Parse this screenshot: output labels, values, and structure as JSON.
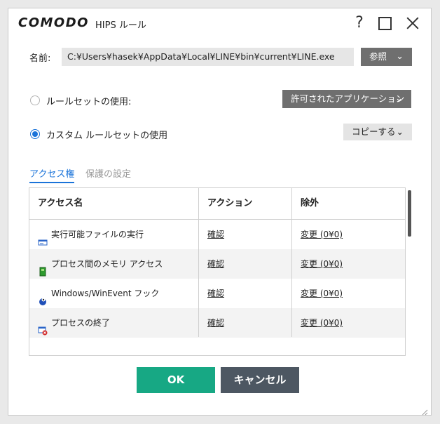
{
  "window": {
    "logo": "COMODO",
    "title": "HIPS ルール",
    "help": "?"
  },
  "name_row": {
    "label": "名前:",
    "path": "C:¥Users¥hasek¥AppData¥Local¥LINE¥bin¥current¥LINE.exe",
    "browse_label": "参照"
  },
  "options": {
    "use_ruleset_label": "ルールセットの使用:",
    "use_ruleset_selected": false,
    "ruleset_dropdown": "許可されたアプリケーション",
    "custom_label": "カスタム ルールセットの使用",
    "custom_selected": true,
    "copy_dropdown": "コピーする"
  },
  "tabs": [
    {
      "label": "アクセス権",
      "active": true
    },
    {
      "label": "保護の設定",
      "active": false
    }
  ],
  "table": {
    "headers": [
      "アクセス名",
      "アクション",
      "除外"
    ],
    "rows": [
      {
        "icon": "run-executable-icon",
        "name": "実行可能ファイルの実行",
        "action": "確認",
        "exclusion": "変更 (0¥0)"
      },
      {
        "icon": "process-memory-icon",
        "name": "プロセス間のメモリ アクセス",
        "action": "確認",
        "exclusion": "変更 (0¥0)"
      },
      {
        "icon": "windows-hook-icon",
        "name": "Windows/WinEvent フック",
        "action": "確認",
        "exclusion": "変更 (0¥0)"
      },
      {
        "icon": "terminate-process-icon",
        "name": "プロセスの終了",
        "action": "確認",
        "exclusion": "変更 (0¥0)"
      }
    ]
  },
  "buttons": {
    "ok": "OK",
    "cancel": "キャンセル"
  },
  "colors": {
    "accent": "#1a73d9",
    "ok": "#17a884",
    "cancel": "#4d5762",
    "dropdown": "#6f6f6f"
  }
}
